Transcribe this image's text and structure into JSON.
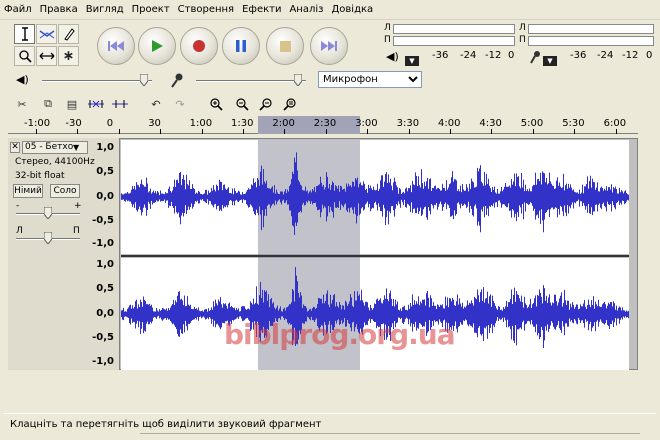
{
  "menu": [
    "Файл",
    "Правка",
    "Вигляд",
    "Проект",
    "Створення",
    "Ефекти",
    "Аналіз",
    "Довідка"
  ],
  "meters": {
    "left_channel": "Л",
    "right_channel": "П",
    "scale": [
      "-36",
      "-24",
      "-12",
      "0"
    ]
  },
  "mixer": {
    "input_source": "Микрофон"
  },
  "ruler": {
    "labels": [
      "-1:00",
      "-30",
      "0",
      "30",
      "1:00",
      "1:30",
      "2:00",
      "2:30",
      "3:00",
      "3:30",
      "4:00",
      "4:30",
      "5:00",
      "5:30",
      "6:00"
    ]
  },
  "track": {
    "name": "05 - Бетхо",
    "format": "Стерео, 44100Hz",
    "bit_depth": "32-bit float",
    "mute_label": "Німий",
    "solo_label": "Соло",
    "gain_minus": "-",
    "gain_plus": "+",
    "pan_left": "Л",
    "pan_right": "П",
    "scale_top": [
      "1,0",
      "0,5",
      "0,0",
      "-0,5",
      "-1,0"
    ],
    "scale_bottom": [
      "1,0",
      "0,5",
      "0,0",
      "-0,5",
      "-1,0"
    ]
  },
  "status": {
    "text": "Клацніть та перетягніть щоб виділити звуковий фрагмент"
  },
  "watermark": "biblprog.org.ua",
  "colors": {
    "waveform": "#3232c8",
    "selection": "#9a9ab0",
    "background": "#ece9d8"
  }
}
